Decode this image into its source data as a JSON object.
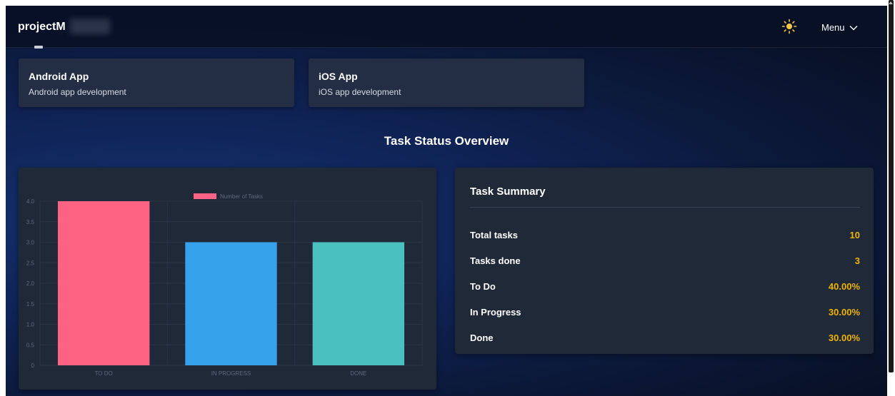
{
  "header": {
    "logo": "projectM",
    "menu_label": "Menu"
  },
  "projects": [
    {
      "title": "Android App",
      "description": "Android app development"
    },
    {
      "title": "iOS App",
      "description": "iOS app development"
    }
  ],
  "section_title": "Task Status Overview",
  "chart_data": {
    "type": "bar",
    "categories": [
      "TO DO",
      "IN PROGRESS",
      "DONE"
    ],
    "series": [
      {
        "name": "Number of Tasks",
        "values": [
          4,
          3,
          3
        ]
      }
    ],
    "colors": [
      "#ff6384",
      "#36a2eb",
      "#4bc0c0"
    ],
    "yticks": [
      "0",
      "0.5",
      "1.0",
      "1.5",
      "2.0",
      "2.5",
      "3.0",
      "3.5",
      "4.0"
    ],
    "ylim": [
      0,
      4
    ],
    "grid": true,
    "legend": "top"
  },
  "summary": {
    "title": "Task Summary",
    "rows": [
      {
        "label": "Total tasks",
        "value": "10"
      },
      {
        "label": "Tasks done",
        "value": "3"
      },
      {
        "label": "To Do",
        "value": "40.00%"
      },
      {
        "label": "In Progress",
        "value": "30.00%"
      },
      {
        "label": "Done",
        "value": "30.00%"
      }
    ]
  },
  "colors": {
    "accent_value": "#f0b400",
    "card_bg": "#1f2938",
    "project_card_bg": "#232e45"
  },
  "icons": {
    "theme_toggle": "sun-icon",
    "menu_chevron": "chevron-down-icon"
  }
}
